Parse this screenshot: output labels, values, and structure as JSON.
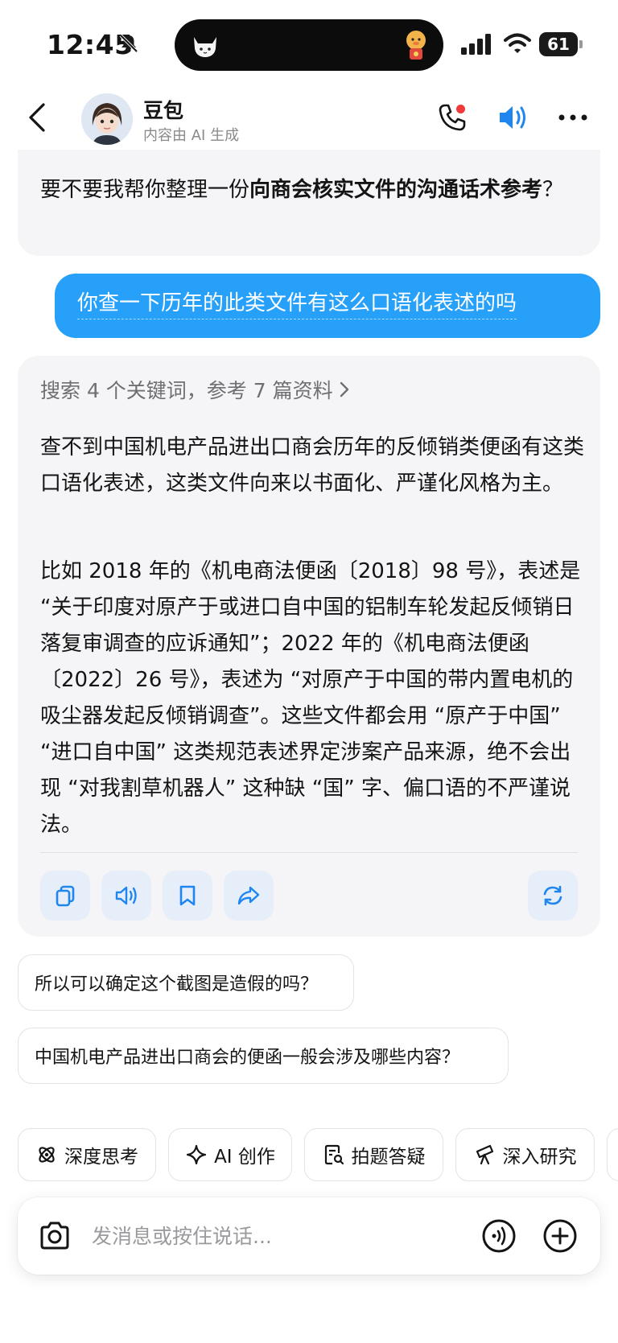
{
  "status": {
    "time": "12:45",
    "battery": "61"
  },
  "header": {
    "name": "豆包",
    "subtitle": "内容由 AI 生成"
  },
  "messages": {
    "ai_prev": {
      "prefix": "要不要我帮你整理一份",
      "bold": "向商会核实文件的沟通话术参考",
      "suffix": "？"
    },
    "user": "你查一下历年的此类文件有这么口语化表述的吗",
    "ai_main": {
      "search_summary": "搜索 4 个关键词，参考 7 篇资料",
      "paragraph1": "查不到中国机电产品进出口商会历年的反倾销类便函有这类口语化表述，这类文件向来以书面化、严谨化风格为主。",
      "paragraph2": "比如 2018 年的《机电商法便函〔2018〕98 号》，表述是 “关于印度对原产于或进口自中国的铝制车轮发起反倾销日落复审调查的应诉通知”；2022 年的《机电商法便函〔2022〕26 号》，表述为 “对原产于中国的带内置电机的吸尘器发起反倾销调查”。这些文件都会用 “原产于中国” “进口自中国” 这类规范表述界定涉案产品来源，绝不会出现 “对我割草机器人” 这种缺 “国” 字、偏口语的不严谨说法。"
    }
  },
  "suggestions": [
    "所以可以确定这个截图是造假的吗？",
    "中国机电产品进出口商会的便函一般会涉及哪些内容？"
  ],
  "tools": [
    {
      "label": "深度思考",
      "icon": "atom-icon"
    },
    {
      "label": "AI 创作",
      "icon": "sparkle-icon"
    },
    {
      "label": "拍题答疑",
      "icon": "scan-doc-icon"
    },
    {
      "label": "深入研究",
      "icon": "telescope-icon"
    }
  ],
  "input": {
    "placeholder": "发消息或按住说话..."
  }
}
